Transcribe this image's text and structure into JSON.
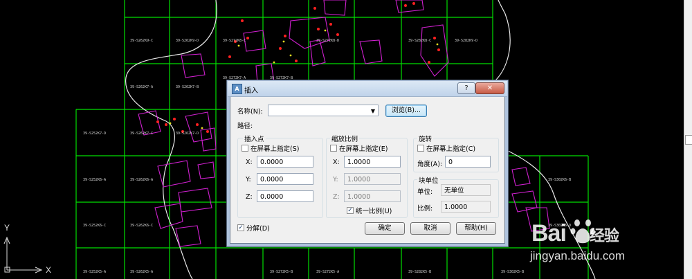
{
  "cad": {
    "axis_x": "X",
    "axis_y": "Y",
    "grid_labels": [
      "39-S262K9-C",
      "39-S262K9-D",
      "39-S272K8-C",
      "39-S272K8-D",
      "39-S282K8-C",
      "39-S282K9-D",
      "39-S262K7-A",
      "39-S262K7-B",
      "39-S272K7-A",
      "39-S272K7-B",
      "39-S252K7-D",
      "39-S262K7-C",
      "39-S262K7-D",
      "39-S252K6-A",
      "39-S262K6-A",
      "39-S302K6-B",
      "39-S252K6-C",
      "39-S262K6-C",
      "39-S302K6-D",
      "39-S252K5-A",
      "39-S262K5-A",
      "39-S272K5-B",
      "39-S272K5-A",
      "39-S282K5-B",
      "39-S302K5-B"
    ]
  },
  "watermark": {
    "logo": "Bai",
    "logo_suffix": "经验",
    "site": "jingyan.baidu.com"
  },
  "dialog": {
    "title": "插入",
    "help_button": "?",
    "close_button": "✕",
    "name_label": "名称(N):",
    "name_value": "",
    "browse_button": "浏览(B)...",
    "path_label": "路径:",
    "insertion_point": {
      "heading": "插入点",
      "specify_on_screen": "在屏幕上指定(S)",
      "x_label": "X:",
      "x_value": "0.0000",
      "y_label": "Y:",
      "y_value": "0.0000",
      "z_label": "Z:",
      "z_value": "0.0000"
    },
    "scale": {
      "heading": "缩放比例",
      "specify_on_screen": "在屏幕上指定(E)",
      "x_label": "X:",
      "x_value": "1.0000",
      "y_label": "Y:",
      "y_value": "1.0000",
      "z_label": "Z:",
      "z_value": "1.0000",
      "uniform_scale": "统一比例(U)",
      "uniform_checked": true
    },
    "rotation": {
      "heading": "旋转",
      "specify_on_screen": "在屏幕上指定(C)",
      "angle_label": "角度(A):",
      "angle_value": "0"
    },
    "block_unit": {
      "heading": "块单位",
      "unit_label": "单位:",
      "unit_value": "无单位",
      "factor_label": "比例:",
      "factor_value": "1.0000"
    },
    "explode_label": "分解(D)",
    "explode_checked": true,
    "ok_button": "确定",
    "cancel_button": "取消",
    "help_text_button": "帮助(H)"
  }
}
